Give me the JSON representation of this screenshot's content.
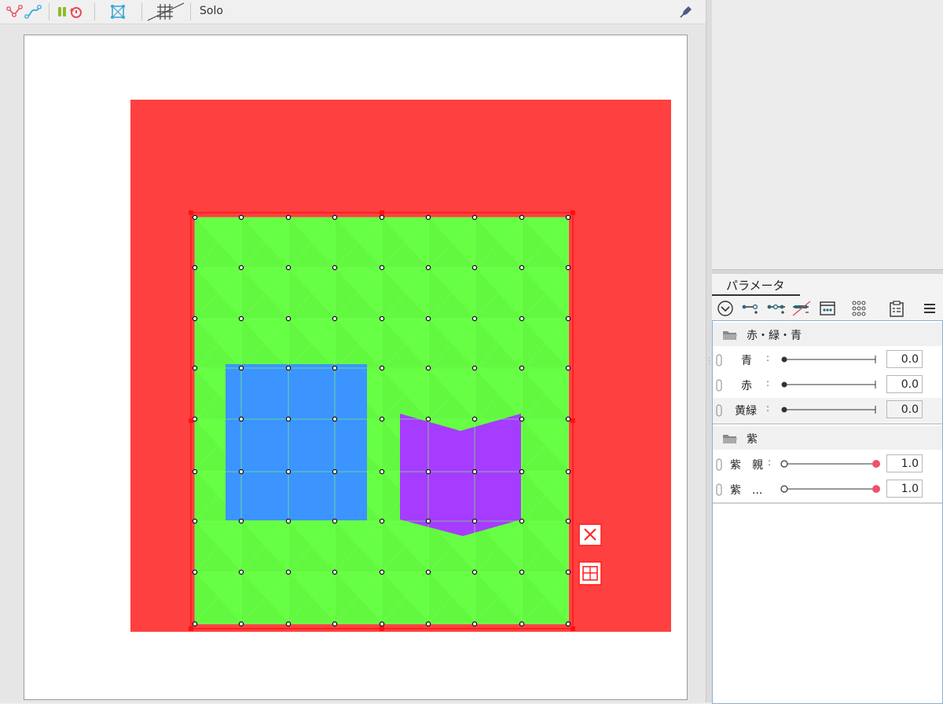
{
  "toolbar": {
    "solo_label": "Solo",
    "icons": [
      "mesh-deform-icon",
      "path-icon",
      "layer-order-icon",
      "reset-icon",
      "mesh-fit-icon",
      "grid-disable-icon",
      "pen-icon"
    ]
  },
  "canvas": {
    "background_color": "#ff4040",
    "mesh_color": "#66ff44",
    "blue_color": "#3c94ff",
    "purple_color": "#a63cff",
    "buttons": [
      "close-mesh-icon",
      "mesh-split-icon"
    ]
  },
  "panel": {
    "tab_label": "パラメータ",
    "tools": [
      "collapse-icon",
      "add-key-icon",
      "add-key-multi-icon",
      "remove-key-icon",
      "preview-icon",
      "key-grid-icon",
      "clipboard-icon",
      "menu-icon"
    ],
    "groups": [
      {
        "name": "赤・緑・青",
        "params": [
          {
            "name": "青",
            "value": "0.0"
          },
          {
            "name": "赤",
            "value": "0.0"
          },
          {
            "name": "黄緑",
            "value": "0.0"
          }
        ]
      },
      {
        "name": "紫",
        "params": [
          {
            "name": "紫　親",
            "value": "1.0"
          },
          {
            "name": "紫　...",
            "value": "1.0"
          }
        ]
      }
    ],
    "accent_color": "#f0506a"
  }
}
